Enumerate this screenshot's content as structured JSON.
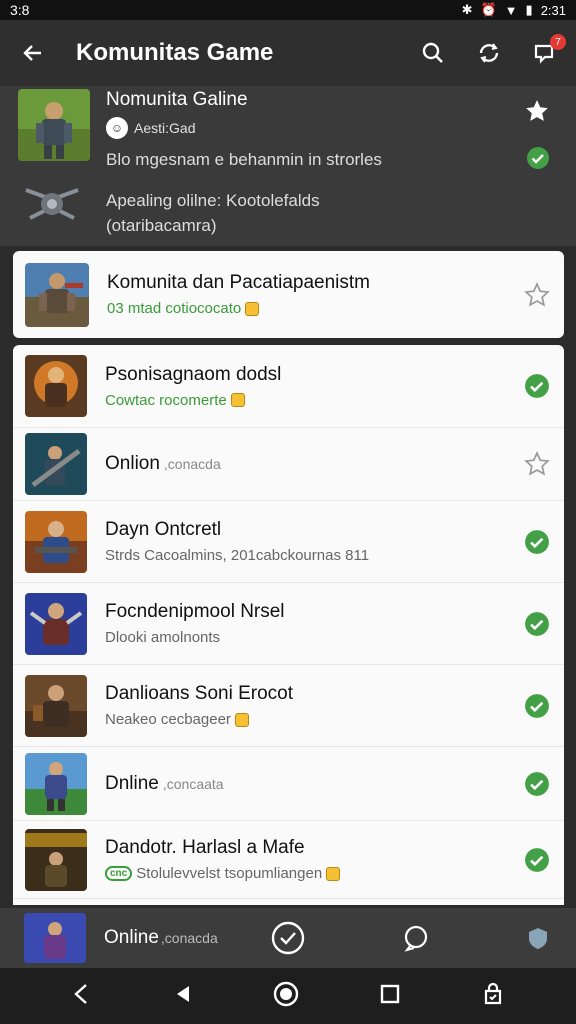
{
  "status_bar": {
    "time": "3:8",
    "clock": "2:31"
  },
  "app_bar": {
    "title": "Komunitas Game",
    "notification_count": "7"
  },
  "header": {
    "title": "Nomunita Galine",
    "author": "Aesti:Gad",
    "line1": "Blo mgesnam e behanmin in strorles",
    "desc1": "Apealing olilne: Kootolefalds",
    "desc2": "(otaribacamra)"
  },
  "featured": {
    "title": "Komunita dan Pacatiapaenistm",
    "subtitle": "03 mtad cotiococato"
  },
  "list": [
    {
      "title": "Psonisagnaom dodsl",
      "subtitle": "Cowtac rocomerte",
      "subtitle_color": "green",
      "coin": true,
      "status": "check"
    },
    {
      "title": "Onlion",
      "inline": ",conacda",
      "status": "star"
    },
    {
      "title": "Dayn Ontcretl",
      "subtitle": "Strds Cacoalmins, 201cabckournas 811",
      "status": "check"
    },
    {
      "title": "Focndenipmool Nrsel",
      "subtitle": "Dlooki amolnonts",
      "status": "check"
    },
    {
      "title": "Danlioans Soni Erocot",
      "subtitle": "Neakeo cecbageer",
      "coin": true,
      "status": "check"
    },
    {
      "title": "Dnline",
      "inline": ",concaata",
      "status": "check"
    },
    {
      "title": "Dandotr. Harlasl a Mafe",
      "subtitle": "Stolulevvelst tsopumliangen",
      "pill": "cnc",
      "coin": true,
      "status": "check"
    }
  ],
  "bottom_strip": {
    "label": "Online",
    "inline": ",conacda"
  },
  "colors": {
    "check_green": "#43a047",
    "badge_red": "#e53935"
  }
}
